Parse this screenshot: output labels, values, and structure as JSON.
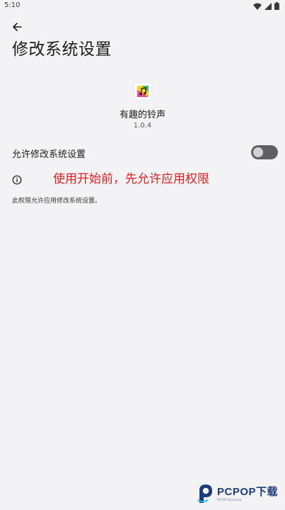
{
  "status_bar": {
    "time": "5:10"
  },
  "header": {
    "title": "修改系统设置"
  },
  "app": {
    "name": "有趣的铃声",
    "version": "1.0.4"
  },
  "setting": {
    "label": "允许修改系统设置",
    "enabled": false
  },
  "annotation": "使用开始前，先允许应用权限",
  "footer": "此权限允许应用修改系统设置。",
  "watermark": {
    "brand": "PCPOP下载",
    "sub": "PCPOP Download"
  },
  "colors": {
    "background": "#f3f3f6",
    "annotation": "#e02020",
    "toggle_track": "#606064",
    "toggle_knob": "#d2d2d6",
    "watermark": "#1b3d7a"
  }
}
